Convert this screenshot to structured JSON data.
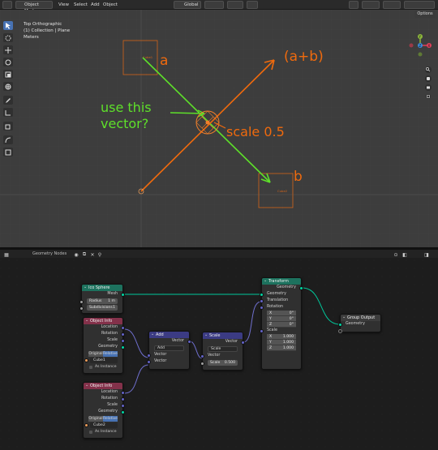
{
  "header": {
    "mode": "Object Mode",
    "menus": [
      "View",
      "Select",
      "Add",
      "Object"
    ],
    "transform_orientation": "Global",
    "options": "Options"
  },
  "viewport": {
    "view_name": "Top Orthographic",
    "collection": "(1) Collection | Plane",
    "units": "Meters",
    "object_a": "Cube1",
    "object_b": "Cube2"
  },
  "annotations": {
    "a": "a",
    "b": "b",
    "sum": "(a+b)",
    "question_line1": "use this",
    "question_line2": "vector?",
    "scale": "scale 0.5"
  },
  "gizmo": {
    "x": "X",
    "y": "Y",
    "z": "Z"
  },
  "node_editor": {
    "title": "Geometry Nodes"
  },
  "nodes": {
    "ico": {
      "title": "Ico Sphere",
      "out": "Mesh",
      "radius_label": "Radius",
      "radius": "1 m",
      "subdiv_label": "Subdivisions",
      "subdiv": "1"
    },
    "obj1": {
      "title": "Object Info",
      "location": "Location",
      "rotation": "Rotation",
      "scale": "Scale",
      "geometry": "Geometry",
      "original": "Original",
      "relative": "Relative",
      "object": "Cube1",
      "as_instance": "As Instance"
    },
    "obj2": {
      "title": "Object Info",
      "location": "Location",
      "rotation": "Rotation",
      "scale": "Scale",
      "geometry": "Geometry",
      "original": "Original",
      "relative": "Relative",
      "object": "Cube2",
      "as_instance": "As Instance"
    },
    "add": {
      "title": "Add",
      "out": "Vector",
      "op": "Add",
      "in1": "Vector",
      "in2": "Vector"
    },
    "scale": {
      "title": "Scale",
      "out": "Vector",
      "op": "Scale",
      "in1": "Vector",
      "scale_label": "Scale",
      "scale": "0.500"
    },
    "transform": {
      "title": "Transform",
      "out": "Geometry",
      "geometry": "Geometry",
      "translation": "Translation",
      "rotation": "Rotation",
      "rx_label": "X",
      "rx": "0°",
      "ry_label": "Y",
      "ry": "0°",
      "rz_label": "Z",
      "rz": "0°",
      "scale": "Scale",
      "sx_label": "X",
      "sx": "1.000",
      "sy_label": "Y",
      "sy": "1.000",
      "sz_label": "Z",
      "sz": "1.000"
    },
    "output": {
      "title": "Group Output",
      "geometry": "Geometry"
    }
  },
  "colors": {
    "geometry_header": "#1d725e",
    "input_header": "#83314a",
    "vector_header": "#3b3b83",
    "output_header": "#3c3c3c",
    "annotation_orange": "#f06a0d",
    "annotation_green": "#5ee02a",
    "active_tool": "#4772b3"
  }
}
